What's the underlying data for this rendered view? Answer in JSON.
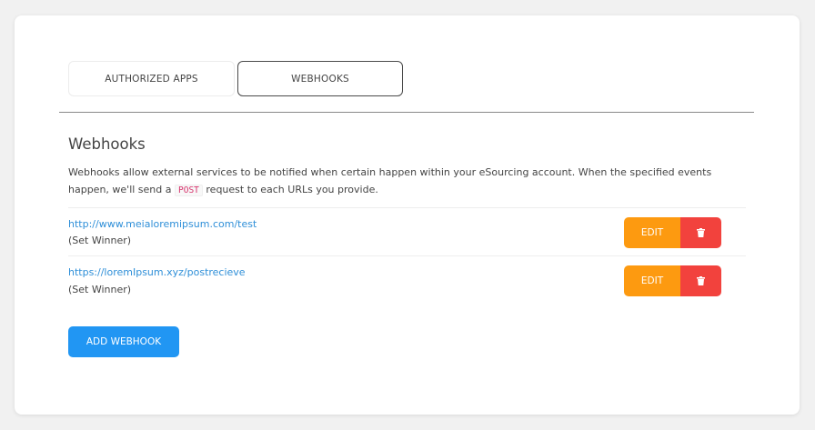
{
  "tabs": [
    {
      "label": "AUTHORIZED APPS",
      "active": false
    },
    {
      "label": "WEBHOOKS",
      "active": true
    }
  ],
  "section": {
    "title": "Webhooks",
    "description_before": "Webhooks allow external services to be notified when certain happen within your eSourcing account. When the specified events happen, we'll send a",
    "method_code": "POST",
    "description_after": "request to each URLs you provide."
  },
  "webhooks": [
    {
      "url": "http://www.meialoremipsum.com/test",
      "event": "(Set Winner)",
      "edit_label": "EDIT",
      "delete_icon": "trash-icon"
    },
    {
      "url": "https://loremIpsum.xyz/postrecieve",
      "event": "(Set Winner)",
      "edit_label": "EDIT",
      "delete_icon": "trash-icon"
    }
  ],
  "add_button_label": "ADD WEBHOOK",
  "colors": {
    "edit": "#fd9a10",
    "delete": "#f2423d",
    "add": "#2196f3",
    "link": "#2f8fd8"
  }
}
